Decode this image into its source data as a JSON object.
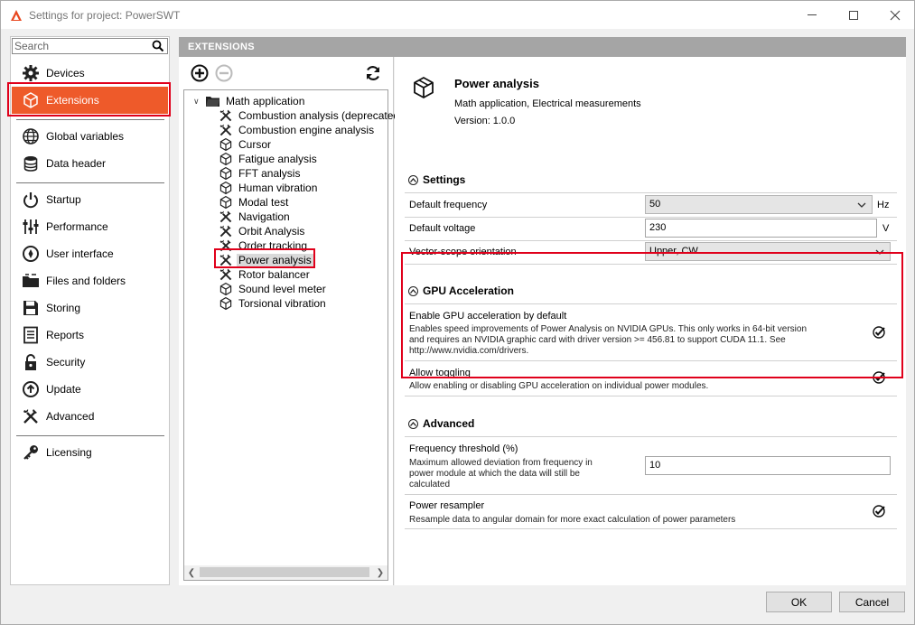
{
  "window": {
    "title": "Settings for project: PowerSWT"
  },
  "search": {
    "placeholder": "Search"
  },
  "nav": {
    "items": [
      {
        "label": "Devices",
        "icon": "gear-icon"
      },
      {
        "label": "Extensions",
        "icon": "cube-icon",
        "selected": true
      },
      {
        "label": "Global variables",
        "icon": "globe-icon"
      },
      {
        "label": "Data header",
        "icon": "database-icon"
      },
      {
        "label": "Startup",
        "icon": "power-icon"
      },
      {
        "label": "Performance",
        "icon": "sliders-icon"
      },
      {
        "label": "User interface",
        "icon": "compass-icon"
      },
      {
        "label": "Files and folders",
        "icon": "folder-icon"
      },
      {
        "label": "Storing",
        "icon": "floppy-icon"
      },
      {
        "label": "Reports",
        "icon": "report-icon"
      },
      {
        "label": "Security",
        "icon": "lock-icon"
      },
      {
        "label": "Update",
        "icon": "update-icon"
      },
      {
        "label": "Advanced",
        "icon": "tools-icon"
      },
      {
        "label": "Licensing",
        "icon": "key-icon"
      }
    ]
  },
  "extensions": {
    "header": "EXTENSIONS",
    "tree": {
      "root": "Math application",
      "children": [
        {
          "label": "Combustion analysis (deprecated)",
          "icon": "tools-icon"
        },
        {
          "label": "Combustion engine analysis",
          "icon": "tools-icon"
        },
        {
          "label": "Cursor",
          "icon": "cube-icon"
        },
        {
          "label": "Fatigue analysis",
          "icon": "cube-icon"
        },
        {
          "label": "FFT analysis",
          "icon": "cube-icon"
        },
        {
          "label": "Human vibration",
          "icon": "cube-icon"
        },
        {
          "label": "Modal test",
          "icon": "cube-icon"
        },
        {
          "label": "Navigation",
          "icon": "tools-icon"
        },
        {
          "label": "Orbit Analysis",
          "icon": "tools-icon"
        },
        {
          "label": "Order tracking",
          "icon": "tools-icon"
        },
        {
          "label": "Power analysis",
          "icon": "tools-icon",
          "selected": true
        },
        {
          "label": "Rotor balancer",
          "icon": "tools-icon"
        },
        {
          "label": "Sound level meter",
          "icon": "cube-icon"
        },
        {
          "label": "Torsional vibration",
          "icon": "cube-icon"
        }
      ]
    }
  },
  "details": {
    "title": "Power analysis",
    "categories": "Math application, Electrical measurements",
    "version": "Version: 1.0.0",
    "settings": {
      "header": "Settings",
      "default_frequency_label": "Default frequency",
      "default_frequency_value": "50",
      "default_frequency_unit": "Hz",
      "default_voltage_label": "Default voltage",
      "default_voltage_value": "230",
      "default_voltage_unit": "V",
      "vector_scope_label": "Vector-scope orientation",
      "vector_scope_value": "Upper, CW"
    },
    "gpu": {
      "header": "GPU Acceleration",
      "enable_title": "Enable GPU acceleration by default",
      "enable_desc_1": "Enables speed improvements of Power Analysis on NVIDIA GPUs. This only works in 64-bit version",
      "enable_desc_2": "and requires an NVIDIA graphic card with driver version >= 456.81 to support CUDA 11.1. See",
      "enable_desc_3": "http://www.nvidia.com/drivers.",
      "enable_checked": true,
      "toggle_title": "Allow toggling",
      "toggle_desc": "Allow enabling or disabling GPU acceleration on individual power modules.",
      "toggle_checked": true
    },
    "advanced": {
      "header": "Advanced",
      "freq_threshold_title": "Frequency threshold (%)",
      "freq_threshold_desc_1": "Maximum allowed deviation from frequency in",
      "freq_threshold_desc_2": "power module at which the data will still be",
      "freq_threshold_desc_3": "calculated",
      "freq_threshold_value": "10",
      "resampler_title": "Power resampler",
      "resampler_desc": "Resample data to angular domain for more exact calculation of power parameters",
      "resampler_checked": true
    }
  },
  "footer": {
    "ok_label": "OK",
    "cancel_label": "Cancel"
  },
  "colors": {
    "accent": "#ee5a2a",
    "highlight_box": "#e0001b",
    "header_bg": "#a5a5a5"
  }
}
